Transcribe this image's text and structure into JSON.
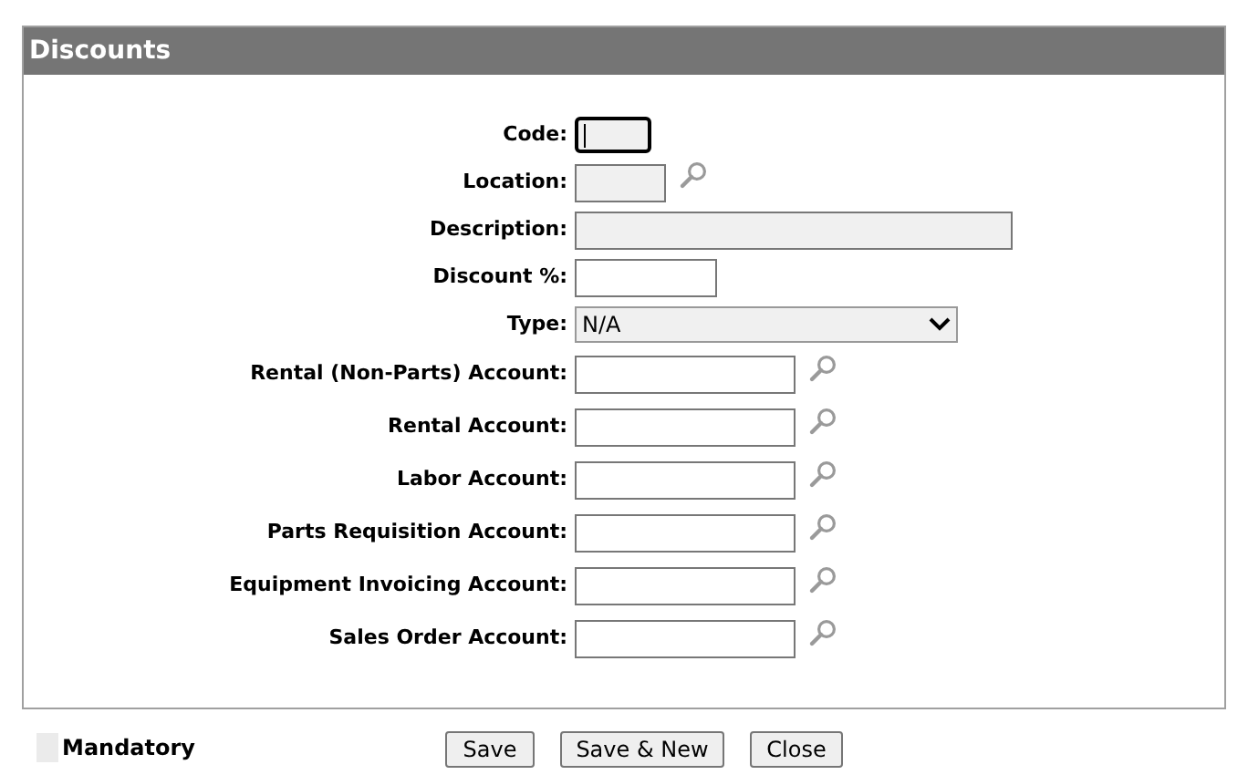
{
  "panel": {
    "title": "Discounts"
  },
  "fields": [
    {
      "label": "Code:",
      "kind": "text",
      "mandatory": true,
      "focused": true,
      "lookup": false
    },
    {
      "label": "Location:",
      "kind": "text",
      "mandatory": true,
      "focused": false,
      "lookup": true
    },
    {
      "label": "Description:",
      "kind": "text",
      "mandatory": true,
      "focused": false,
      "lookup": false
    },
    {
      "label": "Discount %:",
      "kind": "text",
      "mandatory": false,
      "focused": false,
      "lookup": false
    },
    {
      "label": "Type:",
      "kind": "select",
      "value": "N/A",
      "mandatory": true,
      "focused": false,
      "lookup": false
    },
    {
      "label": "Rental (Non-Parts) Account:",
      "kind": "text",
      "mandatory": false,
      "focused": false,
      "lookup": true
    },
    {
      "label": "Rental Account:",
      "kind": "text",
      "mandatory": false,
      "focused": false,
      "lookup": true
    },
    {
      "label": "Labor Account:",
      "kind": "text",
      "mandatory": false,
      "focused": false,
      "lookup": true
    },
    {
      "label": "Parts Requisition Account:",
      "kind": "text",
      "mandatory": false,
      "focused": false,
      "lookup": true
    },
    {
      "label": "Equipment Invoicing Account:",
      "kind": "text",
      "mandatory": false,
      "focused": false,
      "lookup": true
    },
    {
      "label": "Sales Order Account:",
      "kind": "text",
      "mandatory": false,
      "focused": false,
      "lookup": true
    }
  ],
  "legend": {
    "label": "Mandatory"
  },
  "buttons": [
    "Save",
    "Save & New",
    "Close"
  ]
}
